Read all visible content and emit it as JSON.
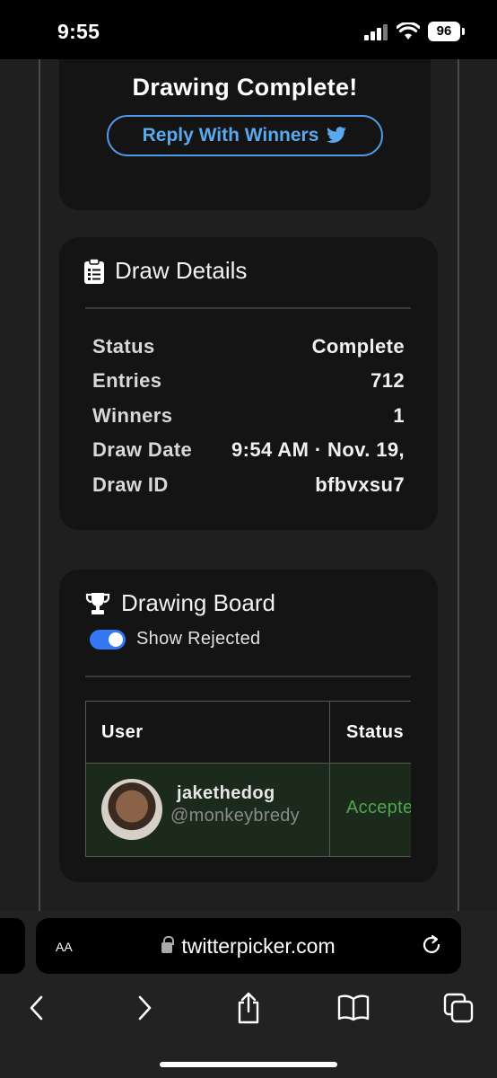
{
  "status_bar": {
    "time": "9:55",
    "battery": "96"
  },
  "drawing": {
    "title": "Drawing Complete!",
    "reply_label": "Reply With Winners"
  },
  "details": {
    "heading": "Draw Details",
    "rows": [
      {
        "label": "Status",
        "value": "Complete"
      },
      {
        "label": "Entries",
        "value": "712"
      },
      {
        "label": "Winners",
        "value": "1"
      },
      {
        "label": "Draw Date",
        "value": "9:54 AM · Nov. 19,"
      },
      {
        "label": "Draw ID",
        "value": "bfbvxsu7"
      }
    ]
  },
  "board": {
    "heading": "Drawing Board",
    "toggle_label": "Show Rejected",
    "toggle_on": true,
    "columns": [
      "User",
      "Status"
    ],
    "rows": [
      {
        "name": "jakethedog",
        "handle": "@monkeybredy",
        "status": "Accepte"
      }
    ]
  },
  "browser": {
    "aa": "AA",
    "url": "twitterpicker.com"
  },
  "colors": {
    "accent": "#4d9ae6",
    "toggle": "#3478f6",
    "accepted": "#4fa64f"
  }
}
